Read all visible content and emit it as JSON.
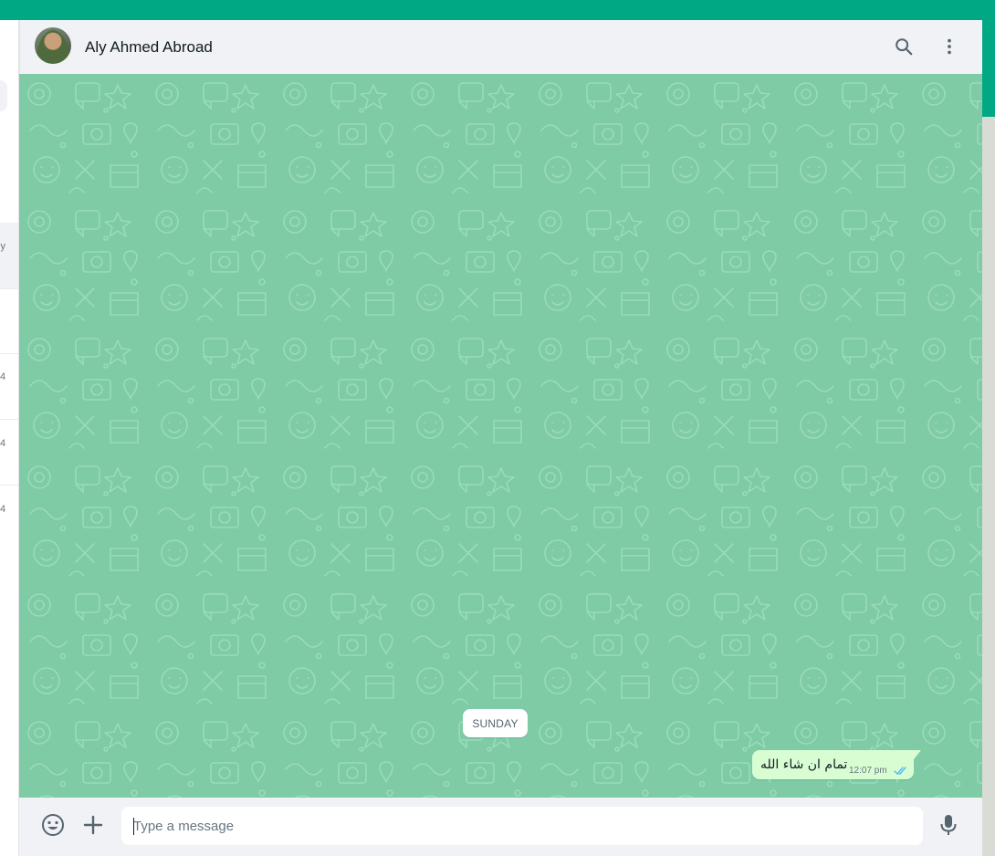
{
  "chat_header": {
    "contact_name": "Aly Ahmed Abroad",
    "icons": [
      "search-icon",
      "menu-kebab-icon"
    ]
  },
  "sidebar_stub": {
    "row_snippets": [
      "y",
      "4",
      "4",
      "4"
    ]
  },
  "conversation": {
    "date_separator": "SUNDAY",
    "messages": [
      {
        "direction": "outgoing",
        "text": "تمام ان شاء الله",
        "time": "12:07 pm",
        "status": "double-check-read"
      }
    ]
  },
  "composer": {
    "placeholder": "Type a message",
    "value": "",
    "icons": [
      "emoji-icon",
      "attach-plus-icon",
      "microphone-icon"
    ]
  },
  "colors": {
    "accent": "#00a884",
    "chat_background": "#7ecba5",
    "outgoing_bubble": "#d9fdd3",
    "header_background": "#f0f2f5",
    "read_ticks": "#53bdeb"
  }
}
